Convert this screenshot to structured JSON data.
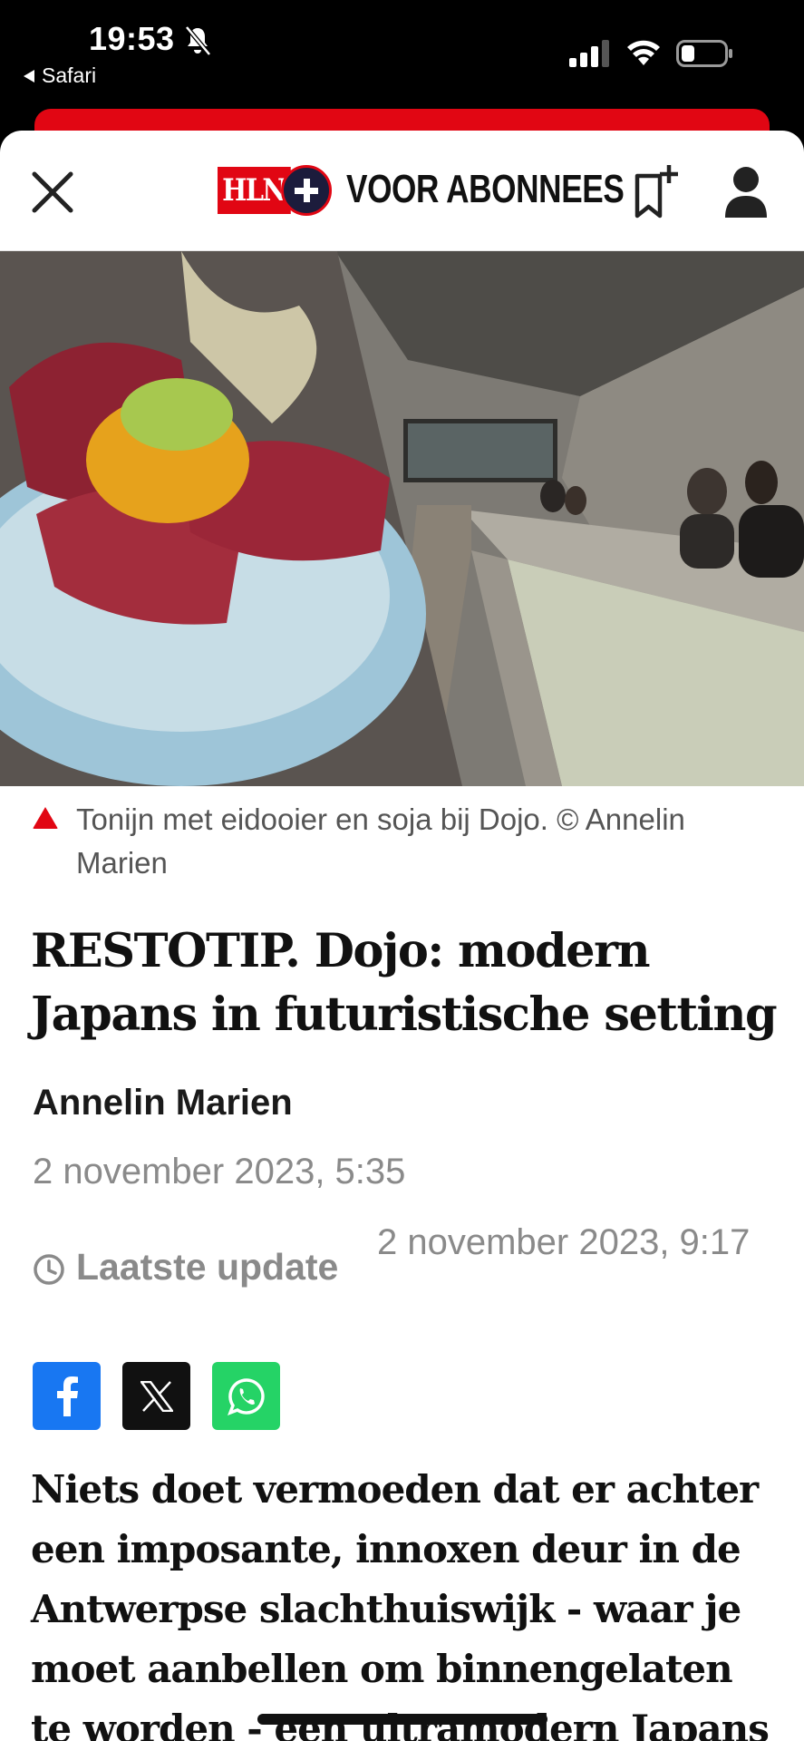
{
  "status_bar": {
    "time": "19:53",
    "back_app": "Safari"
  },
  "header": {
    "logo_text": "HLN",
    "subscriber_label": "VOOR ABONNEES"
  },
  "hero": {
    "image_description": "Tuna dish with egg yolk and a long concrete bar in a restaurant"
  },
  "caption": {
    "text": "Tonijn met eidooier en soja bij Dojo. © Annelin Marien"
  },
  "article": {
    "title": "RESTOTIP. Dojo: modern Japans in futuristische setting",
    "author": "Annelin Marien",
    "published": "2 november 2023, 5:35",
    "update_label": "Laatste update",
    "update_date": "2 november 2023, 9:17",
    "lead": "Niets doet vermoeden dat er achter een imposante, innoxen deur in de Antwerpse slachthuiswijk - waar je moet aanbellen om binnengelaten te worden - een ultramodern Japans"
  },
  "share": {
    "icons": [
      "facebook-icon",
      "x-icon",
      "whatsapp-icon"
    ]
  },
  "colors": {
    "brand_red": "#e10613",
    "facebook": "#1877f2",
    "whatsapp": "#25d366"
  }
}
